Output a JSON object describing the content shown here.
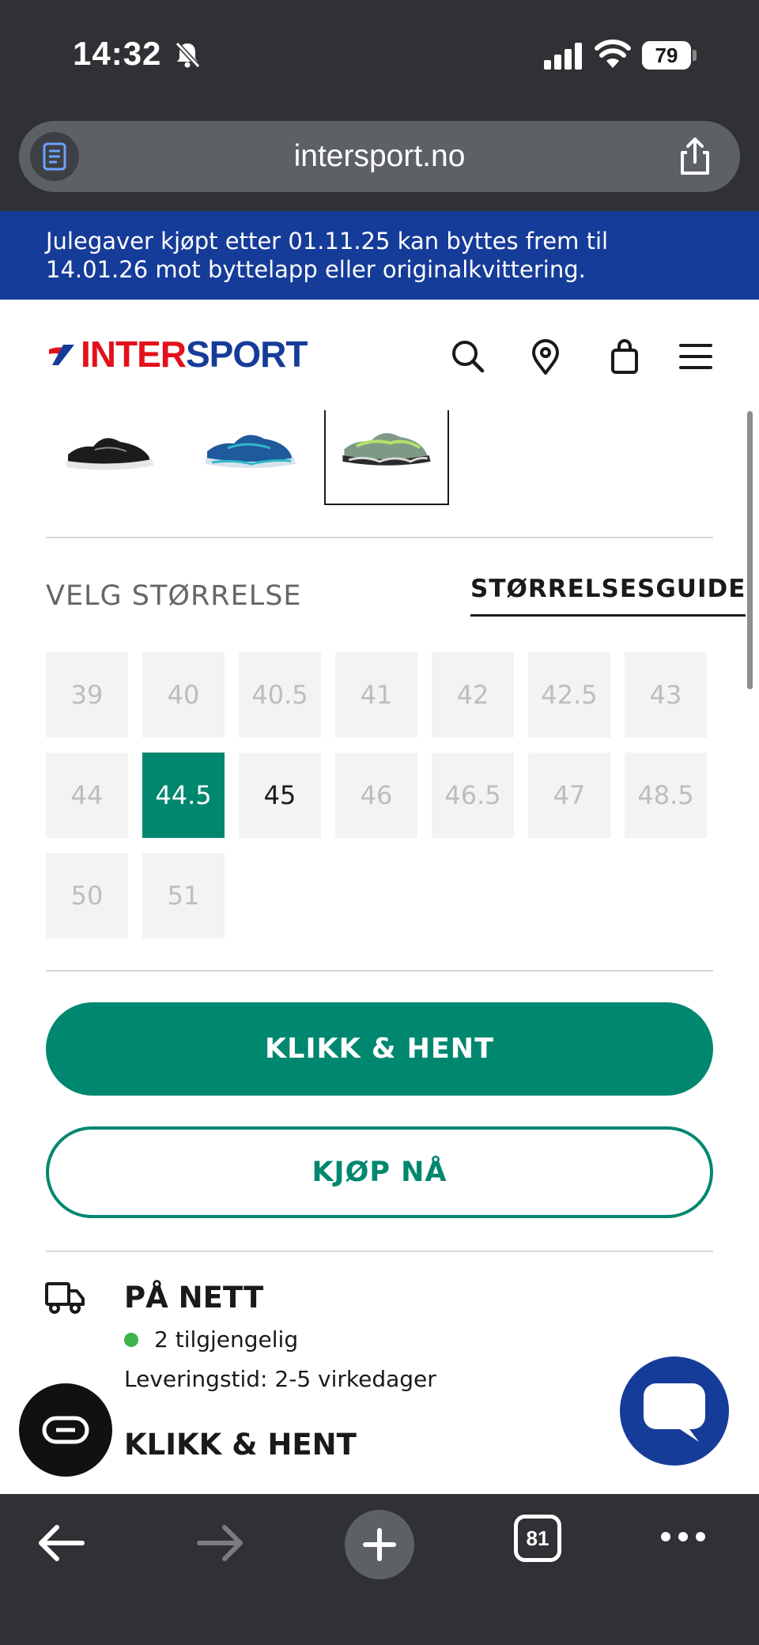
{
  "status_bar": {
    "time": "14:32",
    "battery_level": "79",
    "battery_fraction": 0.79
  },
  "browser": {
    "url": "intersport.no",
    "tab_count": "81"
  },
  "promo": {
    "text": "Julegaver kjøpt etter 01.11.25 kan byttes frem til 14.01.26 mot byttelapp eller originalkvittering."
  },
  "brand": {
    "logo_part1": "INTER",
    "logo_part2": "SPORT",
    "colors": {
      "red": "#e3111b",
      "blue": "#163c99",
      "green": "#00876f"
    }
  },
  "header": {
    "icons": [
      "search-icon",
      "store-location-icon",
      "shopping-bag-icon",
      "menu-icon"
    ]
  },
  "product": {
    "variants": [
      {
        "color_name": "black",
        "selected": false
      },
      {
        "color_name": "blue",
        "selected": false
      },
      {
        "color_name": "green-grey",
        "selected": true
      }
    ]
  },
  "size_picker": {
    "label": "VELG STØRRELSE",
    "guide_link": "STØRRELSESGUIDE",
    "sizes": [
      {
        "label": "39",
        "state": "unavailable"
      },
      {
        "label": "40",
        "state": "unavailable"
      },
      {
        "label": "40.5",
        "state": "unavailable"
      },
      {
        "label": "41",
        "state": "unavailable"
      },
      {
        "label": "42",
        "state": "unavailable"
      },
      {
        "label": "42.5",
        "state": "unavailable"
      },
      {
        "label": "43",
        "state": "unavailable"
      },
      {
        "label": "44",
        "state": "unavailable"
      },
      {
        "label": "44.5",
        "state": "selected"
      },
      {
        "label": "45",
        "state": "available"
      },
      {
        "label": "46",
        "state": "unavailable"
      },
      {
        "label": "46.5",
        "state": "unavailable"
      },
      {
        "label": "47",
        "state": "unavailable"
      },
      {
        "label": "48.5",
        "state": "unavailable"
      },
      {
        "label": "50",
        "state": "unavailable"
      },
      {
        "label": "51",
        "state": "unavailable"
      }
    ]
  },
  "actions": {
    "click_collect_label": "KLIKK & HENT",
    "buy_now_label": "KJØP NÅ"
  },
  "delivery": {
    "online_title": "PÅ NETT",
    "stock_text": "2 tilgjengelig",
    "delivery_time": "Leveringstid: 2-5 virkedager",
    "pickup_title": "KLIKK & HENT"
  }
}
